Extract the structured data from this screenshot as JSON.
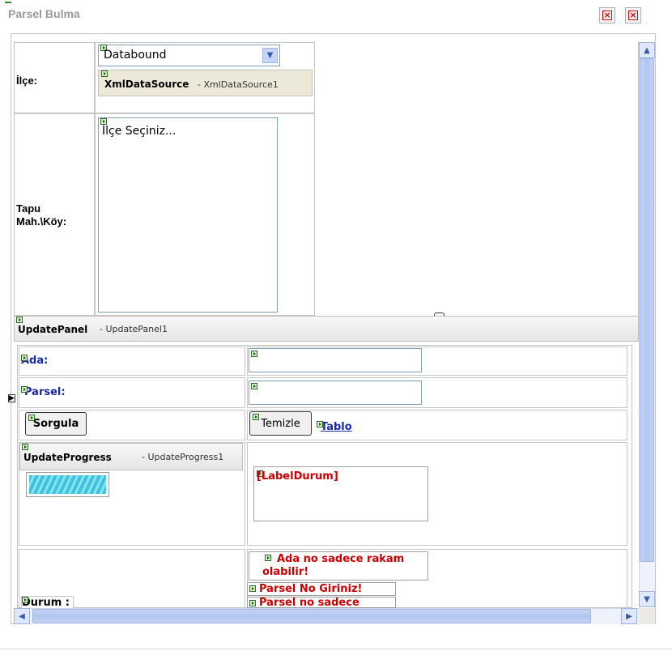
{
  "window": {
    "title": "Parsel Bulma"
  },
  "ilce": {
    "label": "İlçe:",
    "dropdown_value": "Databound",
    "datasource_control": "XmlDataSource",
    "datasource_id": "- XmlDataSource1"
  },
  "mahalle": {
    "label_line1": "Tapu",
    "label_line2": "Mah.\\Köy:",
    "listbox_item": "İlçe Seçiniz..."
  },
  "update_panel": {
    "control": "UpdatePanel",
    "id": "- UpdatePanel1"
  },
  "form": {
    "ada_label": "Ada:",
    "parsel_label": "Parsel:",
    "sorgula_button": "Sorgula",
    "temizle_button": "Temizle",
    "tablo_link": "Tablo"
  },
  "update_progress": {
    "control": "UpdateProgress",
    "id": "- UpdateProgress1"
  },
  "label_durum": "[LabelDurum]",
  "durum": {
    "label": "Durum :",
    "validator1": "Ada no sadece rakam olabilir!",
    "validator2": "Parsel No Giriniz!",
    "validator3": "Parsel no sadece"
  },
  "colors": {
    "validator_red": "#cc0000",
    "link_blue": "#1a2aa0",
    "scroll_blue": "#b2c6f0"
  }
}
